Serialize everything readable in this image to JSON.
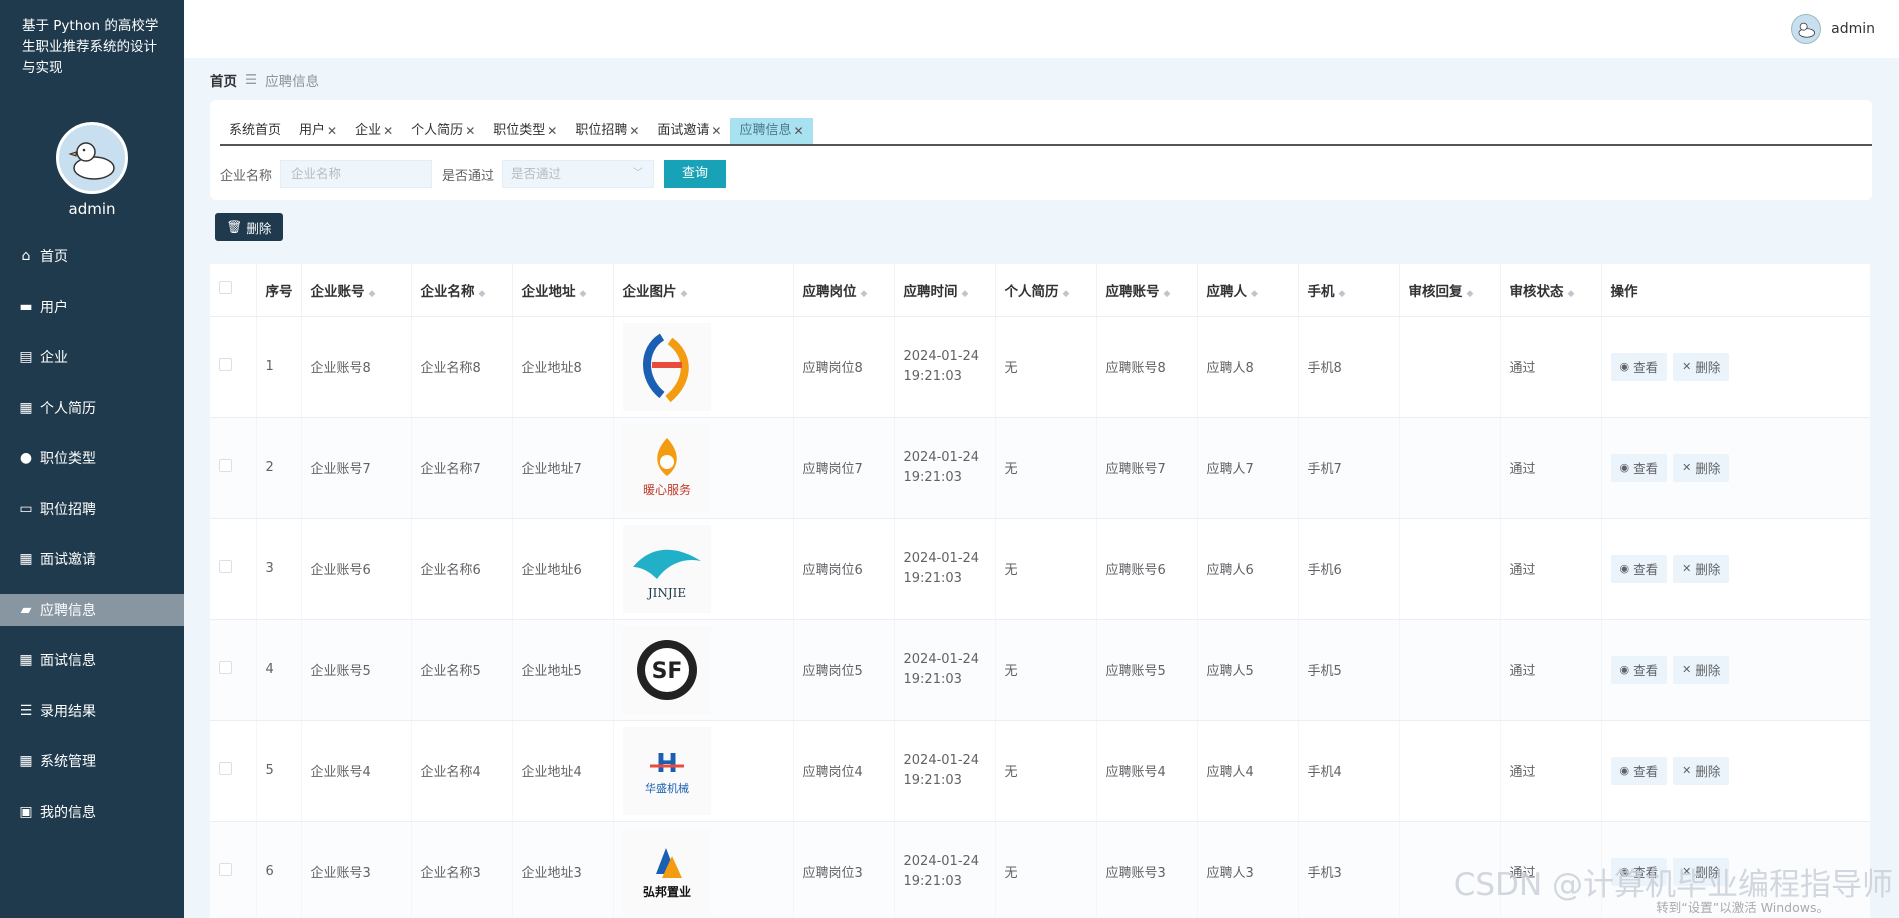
{
  "sidebar": {
    "system_title": "基于 Python 的高校学生职业推荐系统的设计与实现",
    "username": "admin",
    "items": [
      {
        "label": "首页",
        "icon": "home-icon"
      },
      {
        "label": "用户",
        "icon": "briefcase-icon"
      },
      {
        "label": "企业",
        "icon": "clipboard-icon"
      },
      {
        "label": "个人简历",
        "icon": "grid-icon"
      },
      {
        "label": "职位类型",
        "icon": "user-icon"
      },
      {
        "label": "职位招聘",
        "icon": "monitor-icon"
      },
      {
        "label": "面试邀请",
        "icon": "grid-icon"
      },
      {
        "label": "应聘信息",
        "icon": "ticket-icon",
        "active": true
      },
      {
        "label": "面试信息",
        "icon": "grid-icon"
      },
      {
        "label": "录用结果",
        "icon": "list-icon"
      },
      {
        "label": "系统管理",
        "icon": "apps-icon"
      },
      {
        "label": "我的信息",
        "icon": "wallet-icon"
      }
    ]
  },
  "header": {
    "username": "admin"
  },
  "breadcrumb": {
    "home": "首页",
    "current": "应聘信息"
  },
  "tabs": [
    {
      "label": "系统首页",
      "closable": false
    },
    {
      "label": "用户",
      "closable": true
    },
    {
      "label": "企业",
      "closable": true
    },
    {
      "label": "个人简历",
      "closable": true
    },
    {
      "label": "职位类型",
      "closable": true
    },
    {
      "label": "职位招聘",
      "closable": true
    },
    {
      "label": "面试邀请",
      "closable": true
    },
    {
      "label": "应聘信息",
      "closable": true,
      "active": true
    }
  ],
  "search": {
    "company_label": "企业名称",
    "company_placeholder": "企业名称",
    "pass_label": "是否通过",
    "pass_placeholder": "是否通过",
    "query_button": "查询"
  },
  "toolbar": {
    "delete_label": "删除"
  },
  "table": {
    "columns": [
      "序号",
      "企业账号",
      "企业名称",
      "企业地址",
      "企业图片",
      "应聘岗位",
      "应聘时间",
      "个人简历",
      "应聘账号",
      "应聘人",
      "手机",
      "审核回复",
      "审核状态",
      "操作"
    ],
    "rows": [
      {
        "no": "1",
        "account": "企业账号8",
        "name": "企业名称8",
        "address": "企业地址8",
        "logo": "logo-swirl",
        "post": "应聘岗位8",
        "time": "2024-01-24 19:21:03",
        "resume": "无",
        "applicant_account": "应聘账号8",
        "applicant": "应聘人8",
        "phone": "手机8",
        "reply": "",
        "status": "通过"
      },
      {
        "no": "2",
        "account": "企业账号7",
        "name": "企业名称7",
        "address": "企业地址7",
        "logo": "logo-nuanxin",
        "post": "应聘岗位7",
        "time": "2024-01-24 19:21:03",
        "resume": "无",
        "applicant_account": "应聘账号7",
        "applicant": "应聘人7",
        "phone": "手机7",
        "reply": "",
        "status": "通过"
      },
      {
        "no": "3",
        "account": "企业账号6",
        "name": "企业名称6",
        "address": "企业地址6",
        "logo": "logo-jinjie",
        "post": "应聘岗位6",
        "time": "2024-01-24 19:21:03",
        "resume": "无",
        "applicant_account": "应聘账号6",
        "applicant": "应聘人6",
        "phone": "手机6",
        "reply": "",
        "status": "通过"
      },
      {
        "no": "4",
        "account": "企业账号5",
        "name": "企业名称5",
        "address": "企业地址5",
        "logo": "logo-sf",
        "post": "应聘岗位5",
        "time": "2024-01-24 19:21:03",
        "resume": "无",
        "applicant_account": "应聘账号5",
        "applicant": "应聘人5",
        "phone": "手机5",
        "reply": "",
        "status": "通过"
      },
      {
        "no": "5",
        "account": "企业账号4",
        "name": "企业名称4",
        "address": "企业地址4",
        "logo": "logo-huasheng",
        "post": "应聘岗位4",
        "time": "2024-01-24 19:21:03",
        "resume": "无",
        "applicant_account": "应聘账号4",
        "applicant": "应聘人4",
        "phone": "手机4",
        "reply": "",
        "status": "通过"
      },
      {
        "no": "6",
        "account": "企业账号3",
        "name": "企业名称3",
        "address": "企业地址3",
        "logo": "logo-hongbang",
        "post": "应聘岗位3",
        "time": "2024-01-24 19:21:03",
        "resume": "无",
        "applicant_account": "应聘账号3",
        "applicant": "应聘人3",
        "phone": "手机3",
        "reply": "",
        "status": "通过"
      }
    ],
    "view_label": "查看",
    "delete_label": "删除"
  },
  "overlay": {
    "watermark": "CSDN @计算机毕业编程指导师",
    "windows_note": "转到“设置”以激活 Windows。"
  }
}
